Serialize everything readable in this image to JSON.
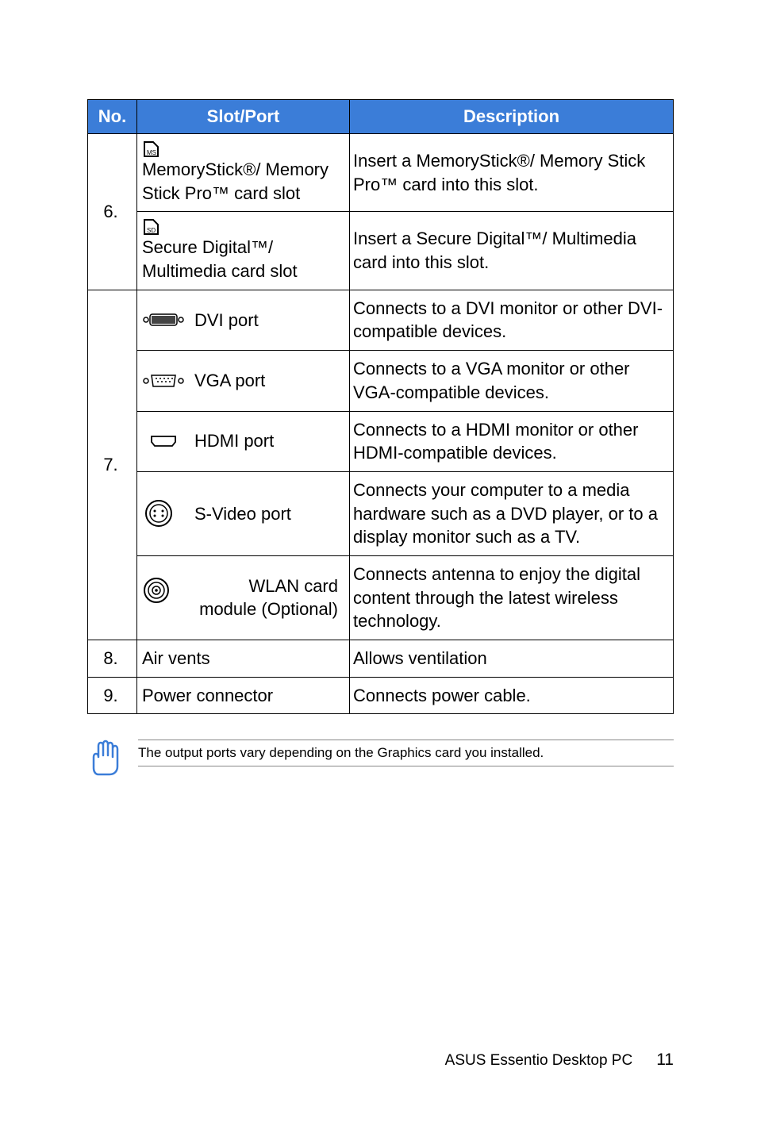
{
  "headers": {
    "no": "No.",
    "slot": "Slot/Port",
    "desc": "Description"
  },
  "rows": {
    "r6": {
      "no": "6.",
      "ms": {
        "label": "MemoryStick®/ Memory Stick Pro™ card slot",
        "desc": "Insert a MemoryStick®/ Memory Stick Pro™ card into this slot."
      },
      "sd": {
        "label": "Secure Digital™/ Multimedia card slot",
        "desc": "Insert a Secure Digital™/ Multimedia card into this slot."
      }
    },
    "r7": {
      "no": "7.",
      "dvi": {
        "label": "DVI port",
        "desc": "Connects to a DVI monitor or other DVI-compatible devices."
      },
      "vga": {
        "label": "VGA port",
        "desc": "Connects to a VGA monitor or other VGA-compatible devices."
      },
      "hdmi": {
        "label": "HDMI port",
        "desc": "Connects to a HDMI monitor or other HDMI-compatible devices."
      },
      "svideo": {
        "label": "S-Video port",
        "desc": "Connects your computer to a media hardware such as a DVD player, or to a display monitor such as a TV."
      },
      "wlan": {
        "label1": "WLAN card",
        "label2": "module (Optional)",
        "desc": "Connects antenna to enjoy the digital content through the latest wireless technology."
      }
    },
    "r8": {
      "no": "8.",
      "label": "Air vents",
      "desc": "Allows ventilation"
    },
    "r9": {
      "no": "9.",
      "label": "Power connector",
      "desc": "Connects power cable."
    }
  },
  "note": "The output ports vary depending on the Graphics card you installed.",
  "footer": {
    "product": "ASUS Essentio Desktop PC",
    "page": "11"
  }
}
